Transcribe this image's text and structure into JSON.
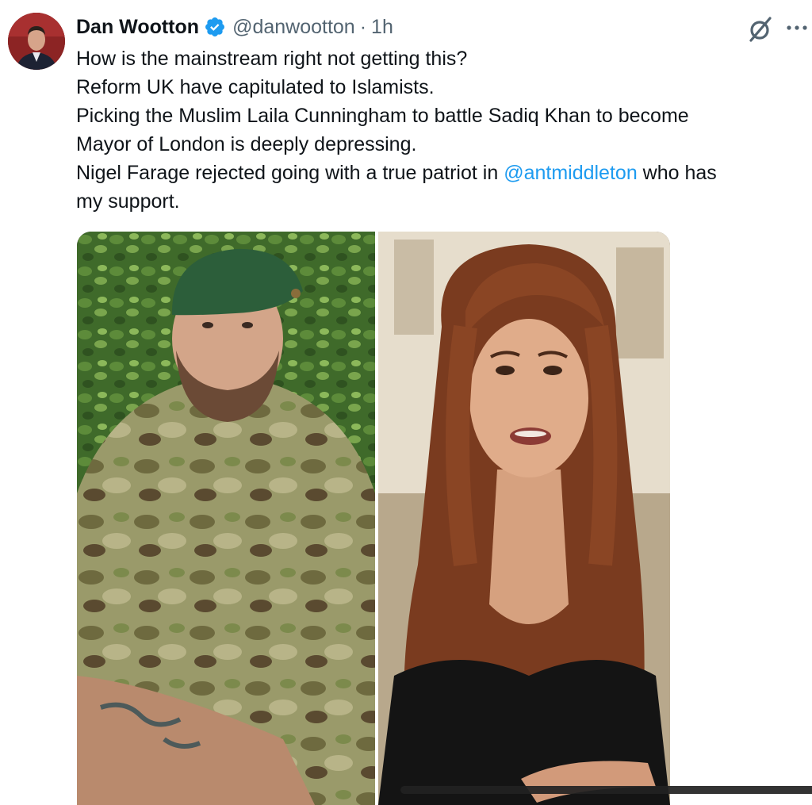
{
  "author": {
    "display_name": "Dan Wootton",
    "handle": "@danwootton",
    "separator": "·",
    "time": "1h",
    "verified": true,
    "avatar_bg": "#7a1f1f"
  },
  "tweet": {
    "lines": [
      "How is the mainstream right not getting this?",
      "Reform UK have capitulated to Islamists.",
      "Picking the Muslim Laila Cunningham to battle Sadiq Khan to become",
      "Mayor of London is deeply depressing."
    ],
    "line5_before": "Nigel Farage rejected going with a true patriot in ",
    "mention": "@antmiddleton",
    "line5_after": " who has",
    "line6": "my support."
  },
  "icons": {
    "verified": "verified-badge-icon",
    "grok": "grok-icon",
    "more": "more-options-icon"
  },
  "colors": {
    "text": "#0f1419",
    "secondary": "#536471",
    "link": "#1d9bf0",
    "verified": "#1d9bf0"
  },
  "media": {
    "left_photo": "man in green beret and camouflage uniform in front of hedge",
    "right_photo": "woman with long auburn hair speaking outdoors"
  }
}
